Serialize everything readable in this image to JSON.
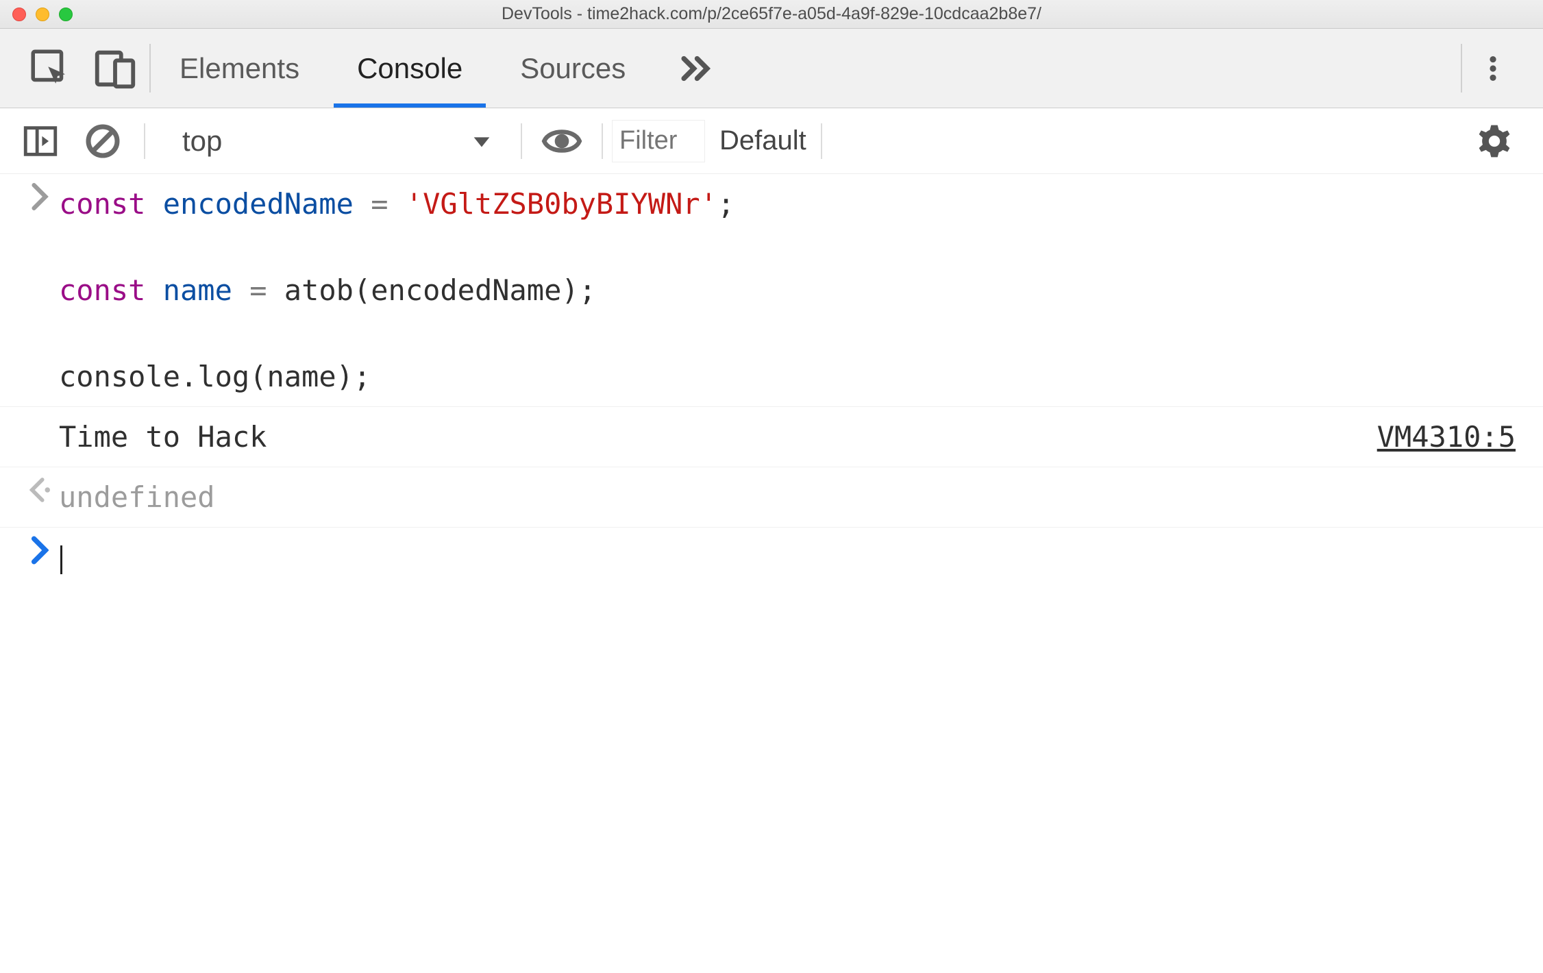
{
  "window": {
    "title": "DevTools - time2hack.com/p/2ce65f7e-a05d-4a9f-829e-10cdcaa2b8e7/"
  },
  "tabs": {
    "elements": "Elements",
    "console": "Console",
    "sources": "Sources"
  },
  "toolbar": {
    "context": "top",
    "filter_placeholder": "Filter",
    "levels_label": "Default"
  },
  "code": {
    "line1": {
      "kw": "const",
      "var": "encodedName",
      "op": "=",
      "str": "'VGltZSB0byBIYWNr'",
      "end": ";"
    },
    "line2": {
      "kw": "const",
      "var": "name",
      "op": "=",
      "fn": "atob",
      "lp": "(",
      "arg": "encodedName",
      "rp": ")",
      "end": ";"
    },
    "line3": {
      "obj": "console",
      "dot": ".",
      "fn": "log",
      "lp": "(",
      "arg": "name",
      "rp": ")",
      "end": ";"
    }
  },
  "log": {
    "message": "Time to Hack",
    "source": "VM4310:5"
  },
  "return": {
    "value": "undefined"
  },
  "gutters": {
    "in": ">",
    "out": "<·",
    "prompt": ">"
  }
}
